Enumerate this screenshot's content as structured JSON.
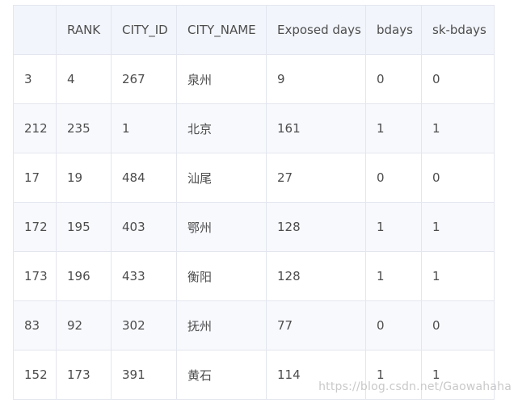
{
  "table": {
    "headers": [
      "",
      "RANK",
      "CITY_ID",
      "CITY_NAME",
      "Exposed days",
      "bdays",
      "sk-bdays"
    ],
    "rows": [
      [
        "3",
        "4",
        "267",
        "泉州",
        "9",
        "0",
        "0"
      ],
      [
        "212",
        "235",
        "1",
        "北京",
        "161",
        "1",
        "1"
      ],
      [
        "17",
        "19",
        "484",
        "汕尾",
        "27",
        "0",
        "0"
      ],
      [
        "172",
        "195",
        "403",
        "鄂州",
        "128",
        "1",
        "1"
      ],
      [
        "173",
        "196",
        "433",
        "衡阳",
        "128",
        "1",
        "1"
      ],
      [
        "83",
        "92",
        "302",
        "抚州",
        "77",
        "0",
        "0"
      ],
      [
        "152",
        "173",
        "391",
        "黄石",
        "114",
        "1",
        "1"
      ]
    ]
  },
  "watermark": "https://blog.csdn.net/Gaowahaha"
}
